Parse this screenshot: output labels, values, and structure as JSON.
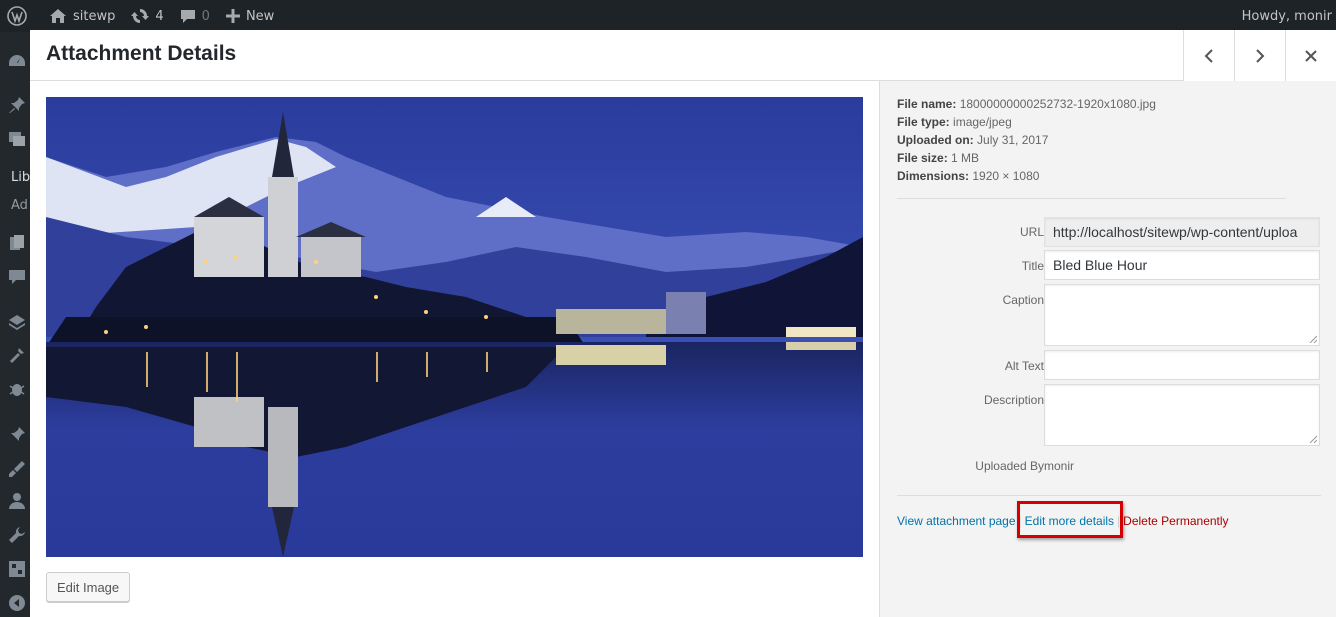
{
  "adminbar": {
    "site_name": "sitewp",
    "updates_count": "4",
    "comments_count": "0",
    "new_label": "New",
    "howdy": "Howdy, monir"
  },
  "sidemenu": {
    "library_label": "Lib",
    "addnew_label": "Ad"
  },
  "modal": {
    "title": "Attachment Details",
    "edit_image_label": "Edit Image"
  },
  "file_info": {
    "name_label": "File name:",
    "name": "18000000000252732-1920x1080.jpg",
    "type_label": "File type:",
    "type": "image/jpeg",
    "uploaded_label": "Uploaded on:",
    "uploaded": "July 31, 2017",
    "size_label": "File size:",
    "size": "1 MB",
    "dimensions_label": "Dimensions:",
    "dimensions": "1920 × 1080"
  },
  "fields": {
    "url_label": "URL",
    "url_value": "http://localhost/sitewp/wp-content/uploa",
    "title_label": "Title",
    "title_value": "Bled Blue Hour",
    "caption_label": "Caption",
    "caption_value": "",
    "alt_label": "Alt Text",
    "alt_value": "",
    "description_label": "Description",
    "description_value": "",
    "uploaded_by_label": "Uploaded By",
    "uploaded_by_value": "monir"
  },
  "actions": {
    "view_label": "View attachment page",
    "edit_label": "Edit more details",
    "delete_label": "Delete Permanently"
  },
  "colors": {
    "link": "#0073aa",
    "danger": "#aa0000",
    "highlight": "#d60000"
  }
}
